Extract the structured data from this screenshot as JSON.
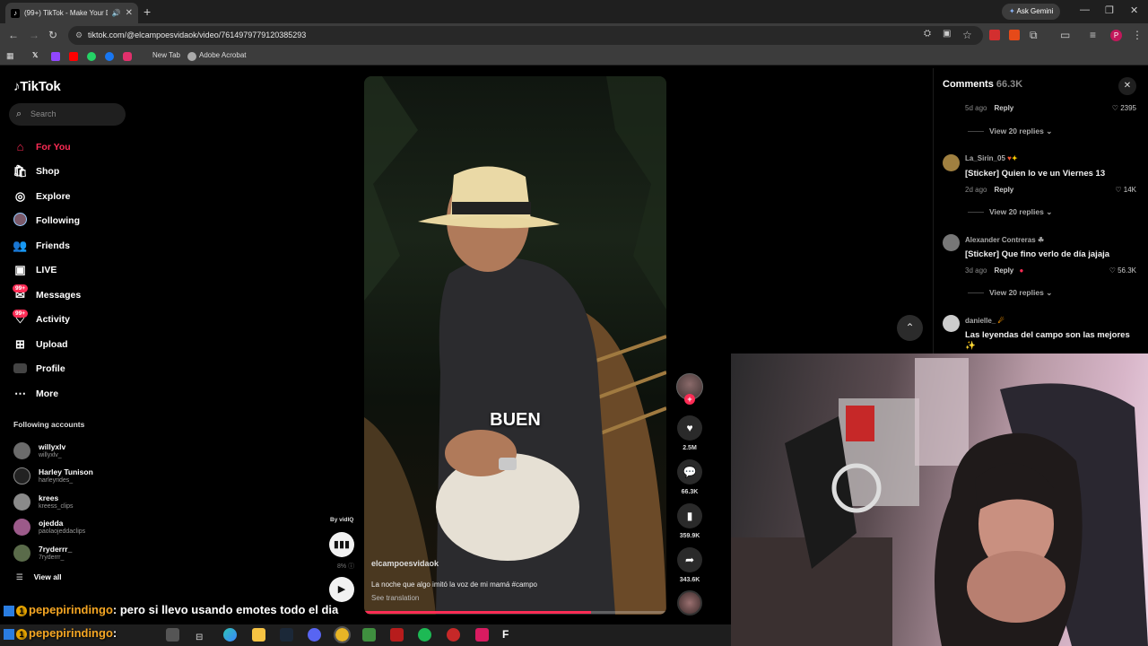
{
  "browser": {
    "tab_title": "(99+) TikTok - Make Your D...",
    "tab_favicon": "tiktok-icon",
    "new_tab_glyph": "+",
    "gemini_label": "Ask Gemini",
    "url": "tiktok.com/@elcampoesvidaok/video/7614979779120385293",
    "bookmarks": [
      "New Tab",
      "Adobe Acrobat"
    ],
    "profile_initial": "P"
  },
  "tiktok": {
    "logo": "TikTok",
    "search_placeholder": "Search",
    "menu": [
      {
        "label": "For You",
        "icon": "home-icon",
        "active": true
      },
      {
        "label": "Shop",
        "icon": "shop-icon"
      },
      {
        "label": "Explore",
        "icon": "compass-icon"
      },
      {
        "label": "Following",
        "icon": "following-avatar-icon"
      },
      {
        "label": "Friends",
        "icon": "friends-icon"
      },
      {
        "label": "LIVE",
        "icon": "live-icon"
      },
      {
        "label": "Messages",
        "icon": "messages-icon",
        "badge": "99+"
      },
      {
        "label": "Activity",
        "icon": "activity-icon",
        "badge": "99+"
      },
      {
        "label": "Upload",
        "icon": "upload-icon"
      },
      {
        "label": "Profile",
        "icon": "profile-icon"
      },
      {
        "label": "More",
        "icon": "more-icon"
      }
    ],
    "following_title": "Following accounts",
    "following": [
      {
        "name": "willyxlv",
        "handle": "willyxlv_"
      },
      {
        "name": "Harley Tunison",
        "handle": "harleyrides_"
      },
      {
        "name": "krees",
        "handle": "kreess_clips"
      },
      {
        "name": "ojedda",
        "handle": "paolaojeddaclips"
      },
      {
        "name": "7ryderrr_",
        "handle": "7ryderrr_"
      }
    ],
    "view_all": "View all"
  },
  "video": {
    "caption_overlay": "BUEN",
    "creator": "elcampoesvidaok",
    "description": "La noche que algo imitó la voz de mi mamá #campo",
    "see_translation": "See translation",
    "progress": 0.75,
    "vidiq_label": "By vidIQ",
    "vidiq_pct": "8%"
  },
  "actions": {
    "likes": "2.5M",
    "comments": "66.3K",
    "saves": "359.9K",
    "shares": "343.6K"
  },
  "comments_panel": {
    "title": "Comments",
    "count": "66.3K",
    "top_meta": {
      "time": "5d ago",
      "reply": "Reply",
      "likes": "2395",
      "view_replies": "View 20 replies"
    },
    "items": [
      {
        "user": "La_Sirin_05",
        "text": "[Sticker] Quien lo ve un Viernes 13",
        "time": "2d ago",
        "reply": "Reply",
        "likes": "14K",
        "view_replies": "View 20 replies"
      },
      {
        "user": "Alexander Contreras",
        "text": "[Sticker] Que fino verlo de día jajaja",
        "time": "3d ago",
        "reply": "Reply",
        "likes": "56.3K",
        "view_replies": "View 20 replies"
      },
      {
        "user": "danielle_",
        "text": "Las leyendas del campo son las mejores ✨"
      }
    ]
  },
  "chat": [
    {
      "user": "pepepirindingo",
      "message": ": pero si llevo usando emotes todo el dia"
    },
    {
      "user": "pepepirindingo",
      "message": ":"
    }
  ],
  "colors": {
    "accent": "#fe2c55",
    "chat_user": "#f5a623"
  }
}
